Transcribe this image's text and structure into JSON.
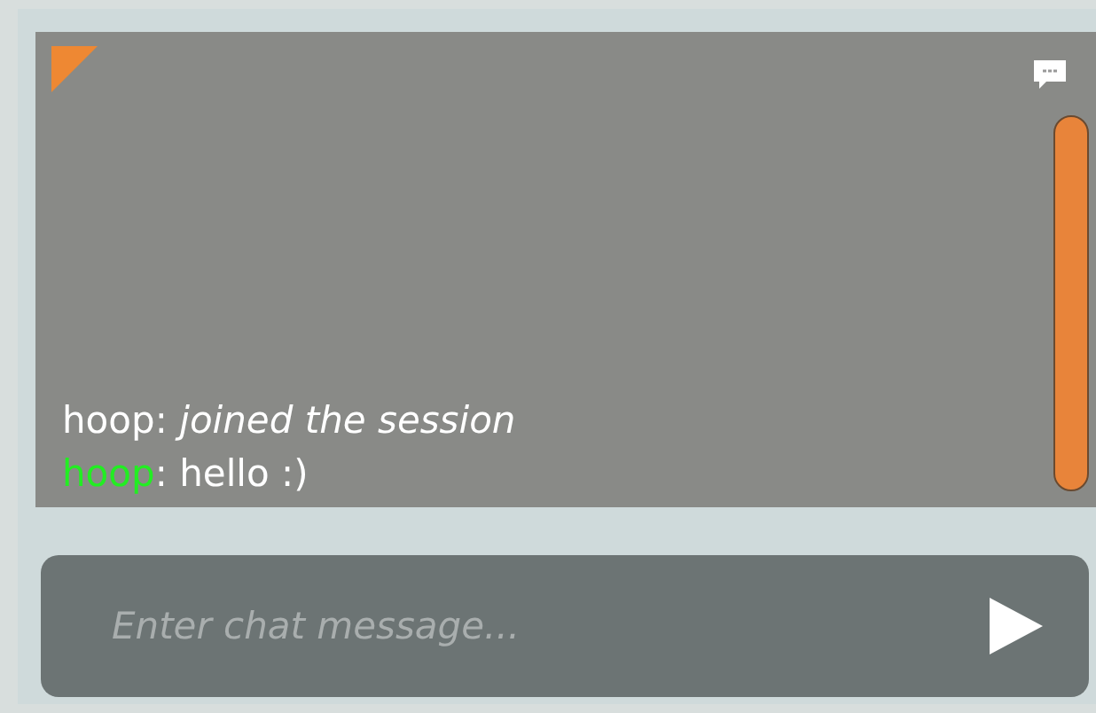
{
  "messages": [
    {
      "kind": "system",
      "name": "hoop",
      "color": "#ffffff",
      "separator": ": ",
      "text": "joined the session"
    },
    {
      "kind": "chat",
      "name": "hoop",
      "color": "#22ee22",
      "separator": ": ",
      "text": "hello :)"
    }
  ],
  "input": {
    "placeholder": "Enter chat message..."
  }
}
